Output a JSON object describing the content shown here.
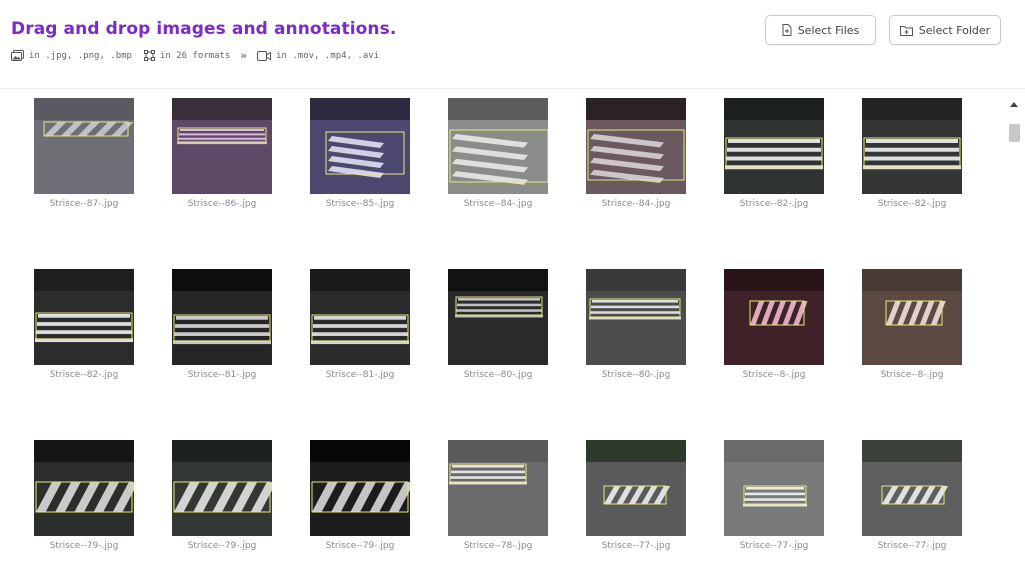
{
  "header": {
    "title": "Drag and drop images and annotations.",
    "formats": [
      {
        "icon": "images-icon",
        "text": "in .jpg, .png, .bmp"
      },
      {
        "icon": "bounding-box-icon",
        "text": "in 26 formats"
      },
      {
        "icon": "video-icon",
        "text": "in .mov, .mp4, .avi"
      }
    ],
    "arrow": "»",
    "select_files_label": "Select Files",
    "select_folder_label": "Select Folder"
  },
  "colors": {
    "title": "#7b2bc9",
    "annotation_box": "#e6ea7a",
    "filename_text": "#8a8a8a"
  },
  "images": [
    {
      "name": "Strisce--87-.jpg"
    },
    {
      "name": "Strisce--86-.jpg"
    },
    {
      "name": "Strisce--85-.jpg"
    },
    {
      "name": "Strisce--84-.jpg"
    },
    {
      "name": "Strisce--84-.jpg"
    },
    {
      "name": "Strisce--82-.jpg"
    },
    {
      "name": "Strisce--82-.jpg"
    },
    {
      "name": "Strisce--82-.jpg"
    },
    {
      "name": "Strisce--81-.jpg"
    },
    {
      "name": "Strisce--81-.jpg"
    },
    {
      "name": "Strisce--80-.jpg"
    },
    {
      "name": "Strisce--80-.jpg"
    },
    {
      "name": "Strisce--8-.jpg"
    },
    {
      "name": "Strisce--8-.jpg"
    },
    {
      "name": "Strisce--79-.jpg"
    },
    {
      "name": "Strisce--79-.jpg"
    },
    {
      "name": "Strisce--79-.jpg"
    },
    {
      "name": "Strisce--78-.jpg"
    },
    {
      "name": "Strisce--77-.jpg"
    },
    {
      "name": "Strisce--77-.jpg"
    },
    {
      "name": "Strisce--77-.jpg"
    }
  ]
}
